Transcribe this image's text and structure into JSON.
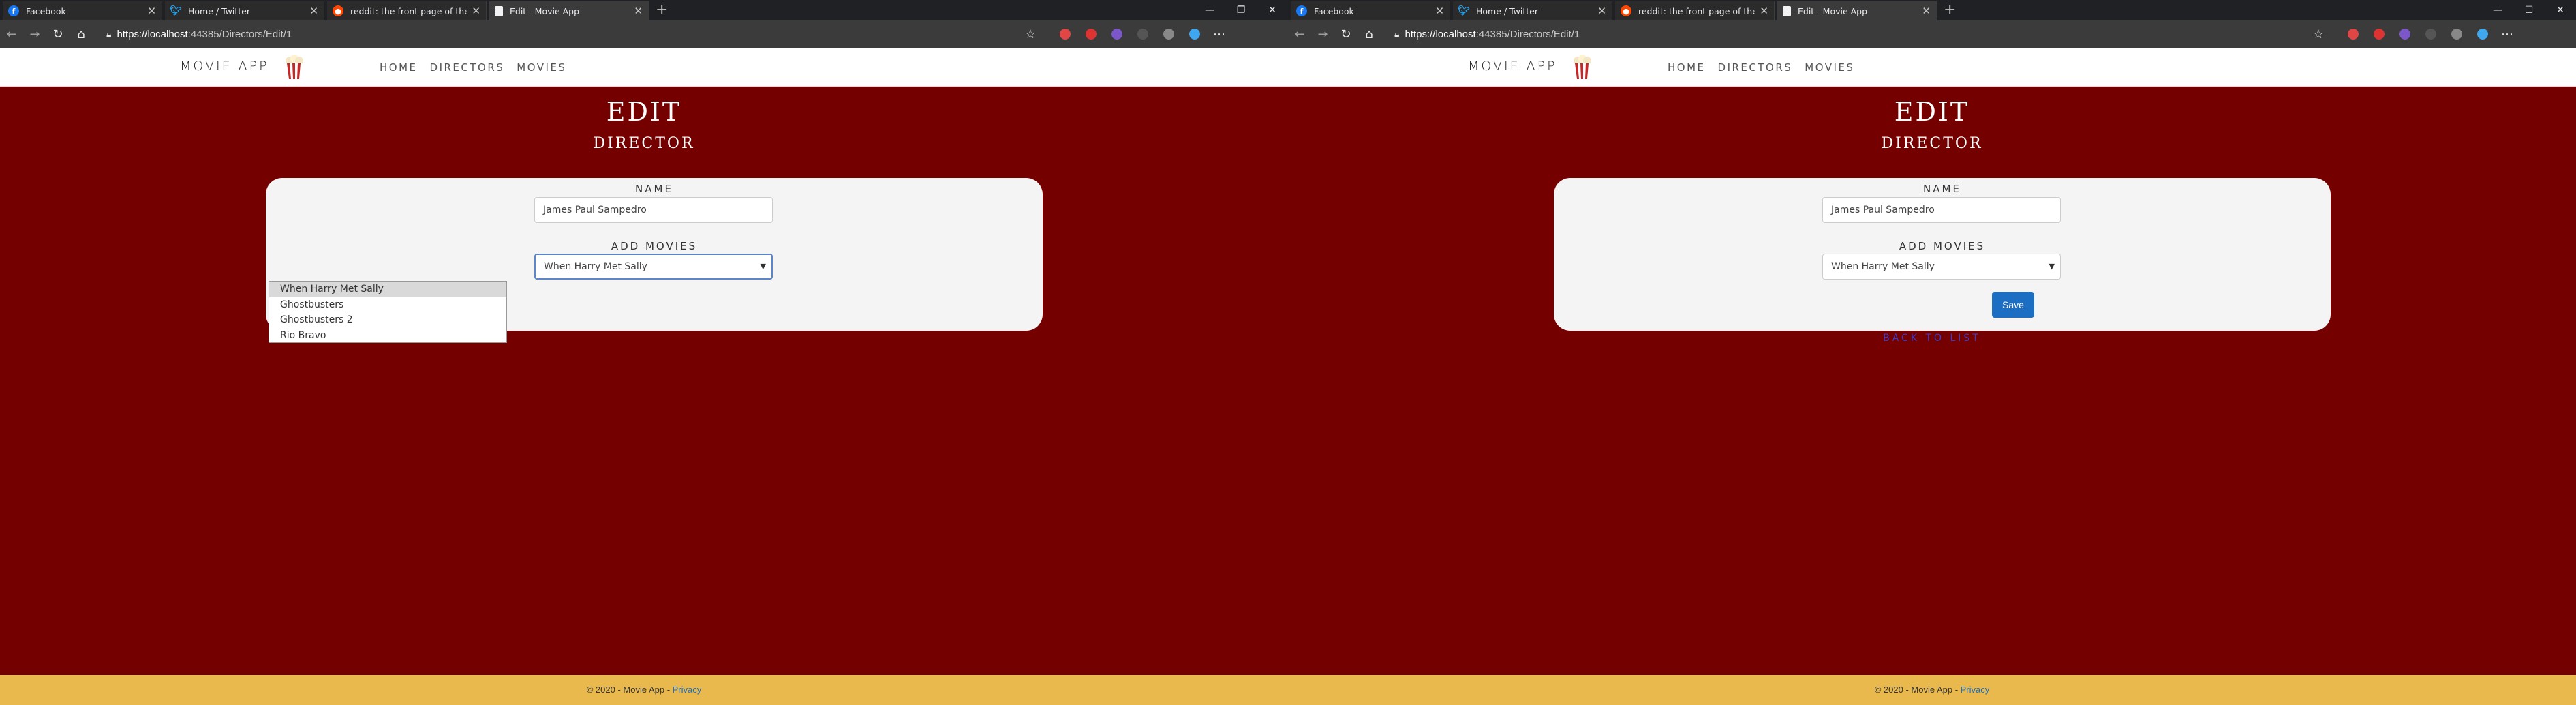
{
  "browser": {
    "tabs": [
      {
        "title": "Facebook",
        "icon": "facebook-icon"
      },
      {
        "title": "Home / Twitter",
        "icon": "twitter-icon"
      },
      {
        "title": "reddit: the front page of the inte",
        "icon": "reddit-icon"
      },
      {
        "title": "Edit - Movie App",
        "icon": "document-icon"
      }
    ],
    "url_host": "https://localhost",
    "url_path": ":44385/Directors/Edit/1"
  },
  "site": {
    "brand": "MOVIE APP",
    "nav": [
      "HOME",
      "DIRECTORS",
      "MOVIES"
    ],
    "heading": "EDIT",
    "subheading": "DIRECTOR",
    "name_label": "NAME",
    "name_value": "James Paul Sampedro",
    "movies_label": "ADD MOVIES",
    "movies_selected": "When Harry Met Sally",
    "movie_options": [
      "When Harry Met Sally",
      "Ghostbusters",
      "Ghostbusters 2",
      "Rio Bravo"
    ],
    "save_label": "Save",
    "back_label": "BACK TO LIST",
    "footer_text": "© 2020 - Movie App - ",
    "footer_privacy": "Privacy"
  },
  "colors": {
    "page_bg": "#740000",
    "footer_bg": "#e9b94d",
    "button": "#1b6ec2"
  }
}
